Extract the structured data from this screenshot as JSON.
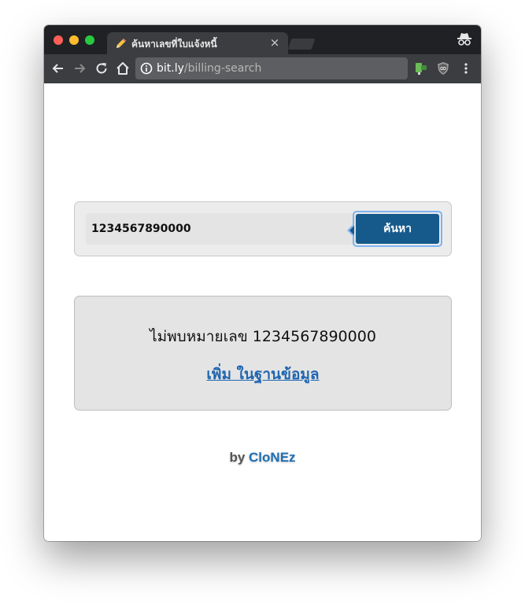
{
  "browser": {
    "tab_title": "ค้นหาเลขที่ใบแจ้งหนี้",
    "tab_close_glyph": "×",
    "url_host": "bit.ly",
    "url_path": "/billing-search"
  },
  "search": {
    "input_value": "1234567890000",
    "button_label": "ค้นหา"
  },
  "result": {
    "message": "ไม่พบหมายเลข 1234567890000",
    "add_link": "เพิ่ม ในฐานข้อมูล"
  },
  "footer": {
    "by": "by",
    "author": "CloNEz"
  },
  "colors": {
    "button": "#165a8c",
    "link": "#2066b0",
    "author": "#1f6fb5"
  },
  "icons": [
    "pencil-icon",
    "close-icon",
    "incognito-icon",
    "back-icon",
    "forward-icon",
    "reload-icon",
    "home-icon",
    "info-icon",
    "extension-icon",
    "ublock-icon",
    "menu-icon"
  ]
}
